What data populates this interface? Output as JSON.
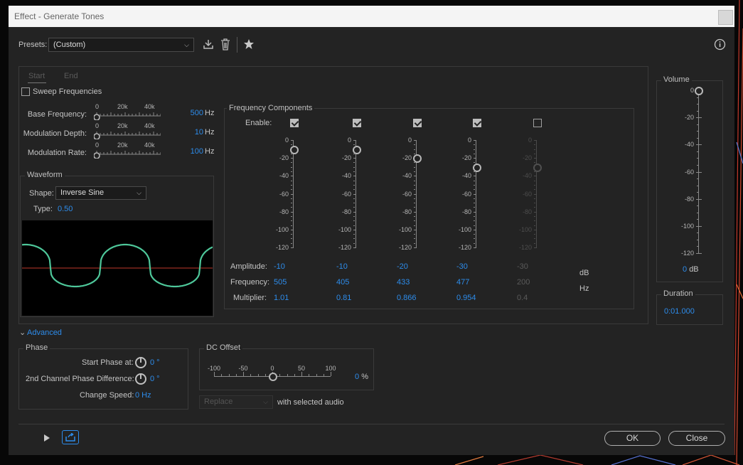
{
  "window": {
    "title": "Effect - Generate Tones"
  },
  "presets": {
    "label": "Presets:",
    "value": "(Custom)",
    "info_icon": "info-icon"
  },
  "tabs": {
    "start": "Start",
    "end": "End"
  },
  "sweep": {
    "label": "Sweep Frequencies",
    "checked": false
  },
  "params": [
    {
      "label": "Base Frequency:",
      "value": "500",
      "unit": "Hz"
    },
    {
      "label": "Modulation Depth:",
      "value": "10",
      "unit": "Hz"
    },
    {
      "label": "Modulation Rate:",
      "value": "100",
      "unit": "Hz"
    }
  ],
  "param_ticks": [
    "0",
    "20k",
    "40k"
  ],
  "waveform": {
    "group": "Waveform",
    "shape_label": "Shape:",
    "shape_value": "Inverse Sine",
    "type_label": "Type:",
    "type_value": "0.50",
    "wave_color": "#4ec79a",
    "baseline_color": "#c0392b"
  },
  "freq": {
    "group": "Frequency Components",
    "enable_label": "Enable:",
    "amplitude_label": "Amplitude:",
    "frequency_label": "Frequency:",
    "multiplier_label": "Multiplier:",
    "unit_db": "dB",
    "unit_hz": "Hz",
    "scale": [
      "0",
      "-20",
      "-40",
      "-60",
      "-80",
      "-100",
      "-120"
    ],
    "components": [
      {
        "enabled": true,
        "amplitude": "-10",
        "frequency": "505",
        "multiplier": "1.01"
      },
      {
        "enabled": true,
        "amplitude": "-10",
        "frequency": "405",
        "multiplier": "0.81"
      },
      {
        "enabled": true,
        "amplitude": "-20",
        "frequency": "433",
        "multiplier": "0.866"
      },
      {
        "enabled": true,
        "amplitude": "-30",
        "frequency": "477",
        "multiplier": "0.954"
      },
      {
        "enabled": false,
        "amplitude": "-30",
        "frequency": "200",
        "multiplier": "0.4"
      }
    ]
  },
  "volume": {
    "group": "Volume",
    "scale": [
      "0",
      "-20",
      "-40",
      "-60",
      "-80",
      "-100",
      "-120"
    ],
    "value": "0",
    "unit": "dB"
  },
  "duration": {
    "group": "Duration",
    "value": "0:01.000"
  },
  "advanced": {
    "label": "Advanced"
  },
  "phase": {
    "group": "Phase",
    "start_label": "Start Phase at:",
    "start_value": "0 °",
    "diff_label": "2nd Channel Phase Difference:",
    "diff_value": "0 °",
    "speed_label": "Change Speed:",
    "speed_value": "0 Hz"
  },
  "dc": {
    "group": "DC Offset",
    "ticks": [
      "-100",
      "-50",
      "0",
      "50",
      "100"
    ],
    "value": "0",
    "unit": "%"
  },
  "mix": {
    "mode": "Replace",
    "suffix": "with selected audio"
  },
  "footer": {
    "ok": "OK",
    "close": "Close"
  }
}
